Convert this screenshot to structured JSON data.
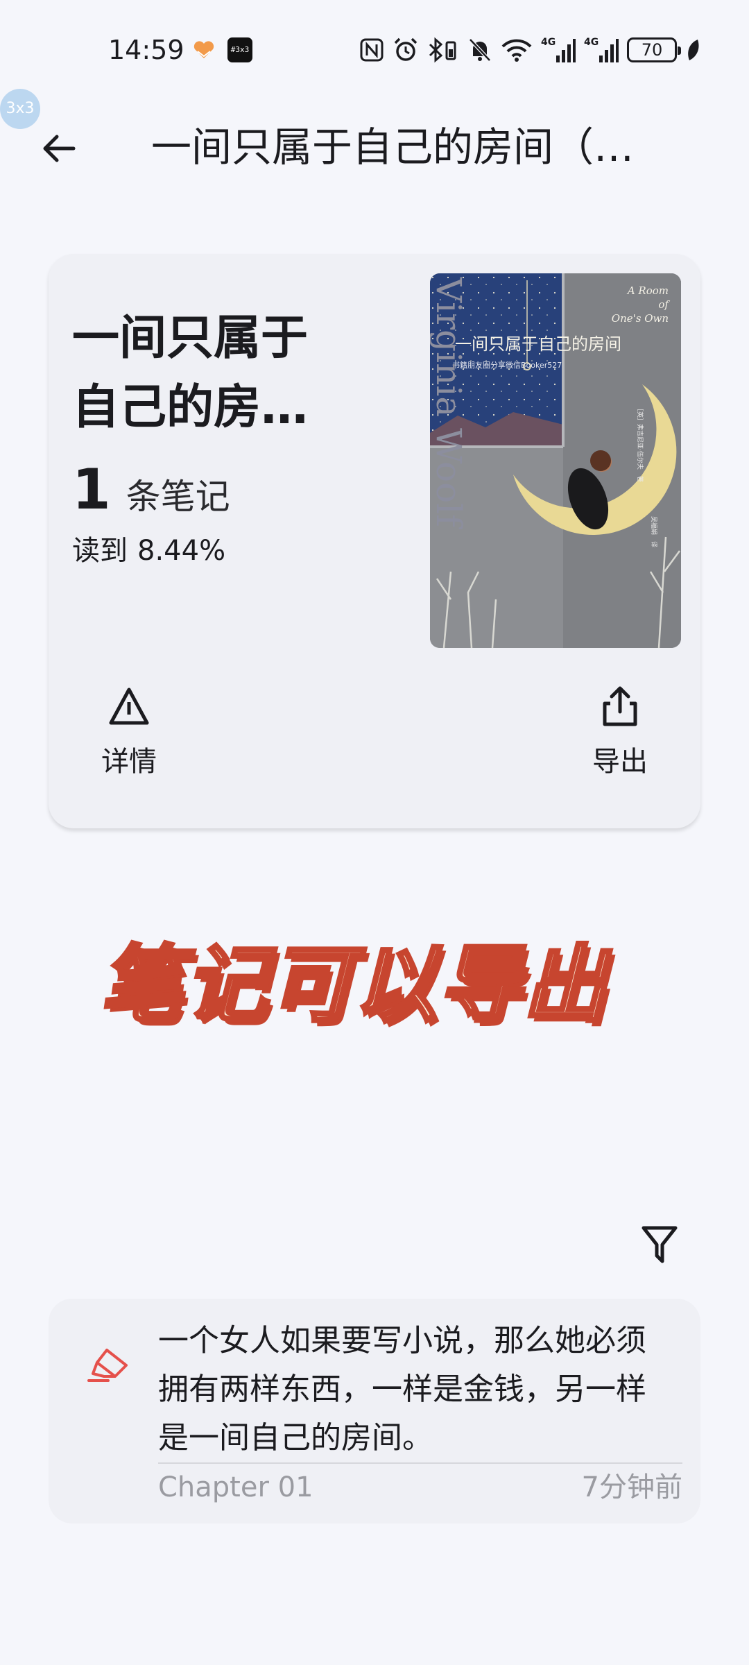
{
  "status_bar": {
    "time": "14:59",
    "battery": "70",
    "app_badge": "#3x3",
    "network_labels": [
      "4G",
      "4G"
    ]
  },
  "floating_badge": "3x3",
  "app_bar": {
    "title": "一间只属于自己的房间（…"
  },
  "book": {
    "title_line1": "一间只属于",
    "title_line2": "自己的房…",
    "note_count": "1",
    "note_count_label": "条笔记",
    "progress_label": "读到",
    "progress_value": "8.44%",
    "cover": {
      "title": "一间只属于自己的房间",
      "subtitle": "书籍朋友圈分享微信Booker527",
      "english_line1": "A Room",
      "english_line2": "of",
      "english_line3": "One's Own",
      "author_vertical": "Virginia Woolf",
      "author_cn": "［英］弗吉尼亚·伍尔夫　著",
      "translator": "吴福娟　译"
    },
    "actions": {
      "details_label": "详情",
      "export_label": "导出"
    }
  },
  "caption": "笔记可以导出",
  "note": {
    "text": "一个女人如果要写小说，那么她必须拥有两样东西，一样是金钱，另一样是一间自己的房间。",
    "chapter": "Chapter 01",
    "time": "7分钟前"
  },
  "colors": {
    "background": "#f5f6fb",
    "card": "#eff0f5",
    "highlight_marker": "#e5504b",
    "caption_fill": "#fbecd7",
    "caption_stroke": "#c7452f"
  }
}
